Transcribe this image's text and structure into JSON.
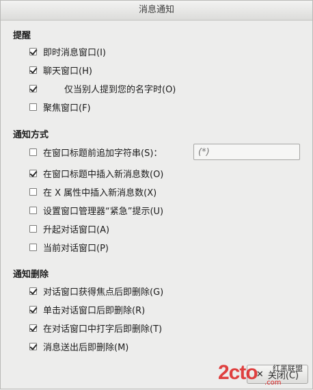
{
  "window": {
    "title": "消息通知"
  },
  "sections": {
    "remind": {
      "title": "提醒",
      "items": [
        {
          "label": "即时消息窗口(I)",
          "checked": true
        },
        {
          "label": "聊天窗口(H)",
          "checked": true
        },
        {
          "label": "仅当别人提到您的名字时(O)",
          "checked": true
        },
        {
          "label": "聚焦窗口(F)",
          "checked": false
        }
      ]
    },
    "method": {
      "title": "通知方式",
      "items": [
        {
          "label": "在窗口标题前追加字符串(S)：",
          "checked": false
        },
        {
          "label": "在窗口标题中插入新消息数(O)",
          "checked": true
        },
        {
          "label": "在 X 属性中插入新消息数(X)",
          "checked": false
        },
        {
          "label": "设置窗口管理器“紧急”提示(U)",
          "checked": false
        },
        {
          "label": "升起对话窗口(A)",
          "checked": false
        },
        {
          "label": "当前对话窗口(P)",
          "checked": false
        }
      ],
      "prefix_input": {
        "placeholder": "(*)"
      }
    },
    "remove": {
      "title": "通知删除",
      "items": [
        {
          "label": "对话窗口获得焦点后即删除(G)",
          "checked": true
        },
        {
          "label": "单击对话窗口后即删除(R)",
          "checked": true
        },
        {
          "label": "在对话窗口中打字后即删除(T)",
          "checked": true
        },
        {
          "label": "消息送出后即删除(M)",
          "checked": true
        }
      ]
    }
  },
  "footer": {
    "close_label": "关闭(C)"
  },
  "watermark": {
    "logo": "2cto",
    "cn": "红黑联盟",
    "url": ".com"
  }
}
